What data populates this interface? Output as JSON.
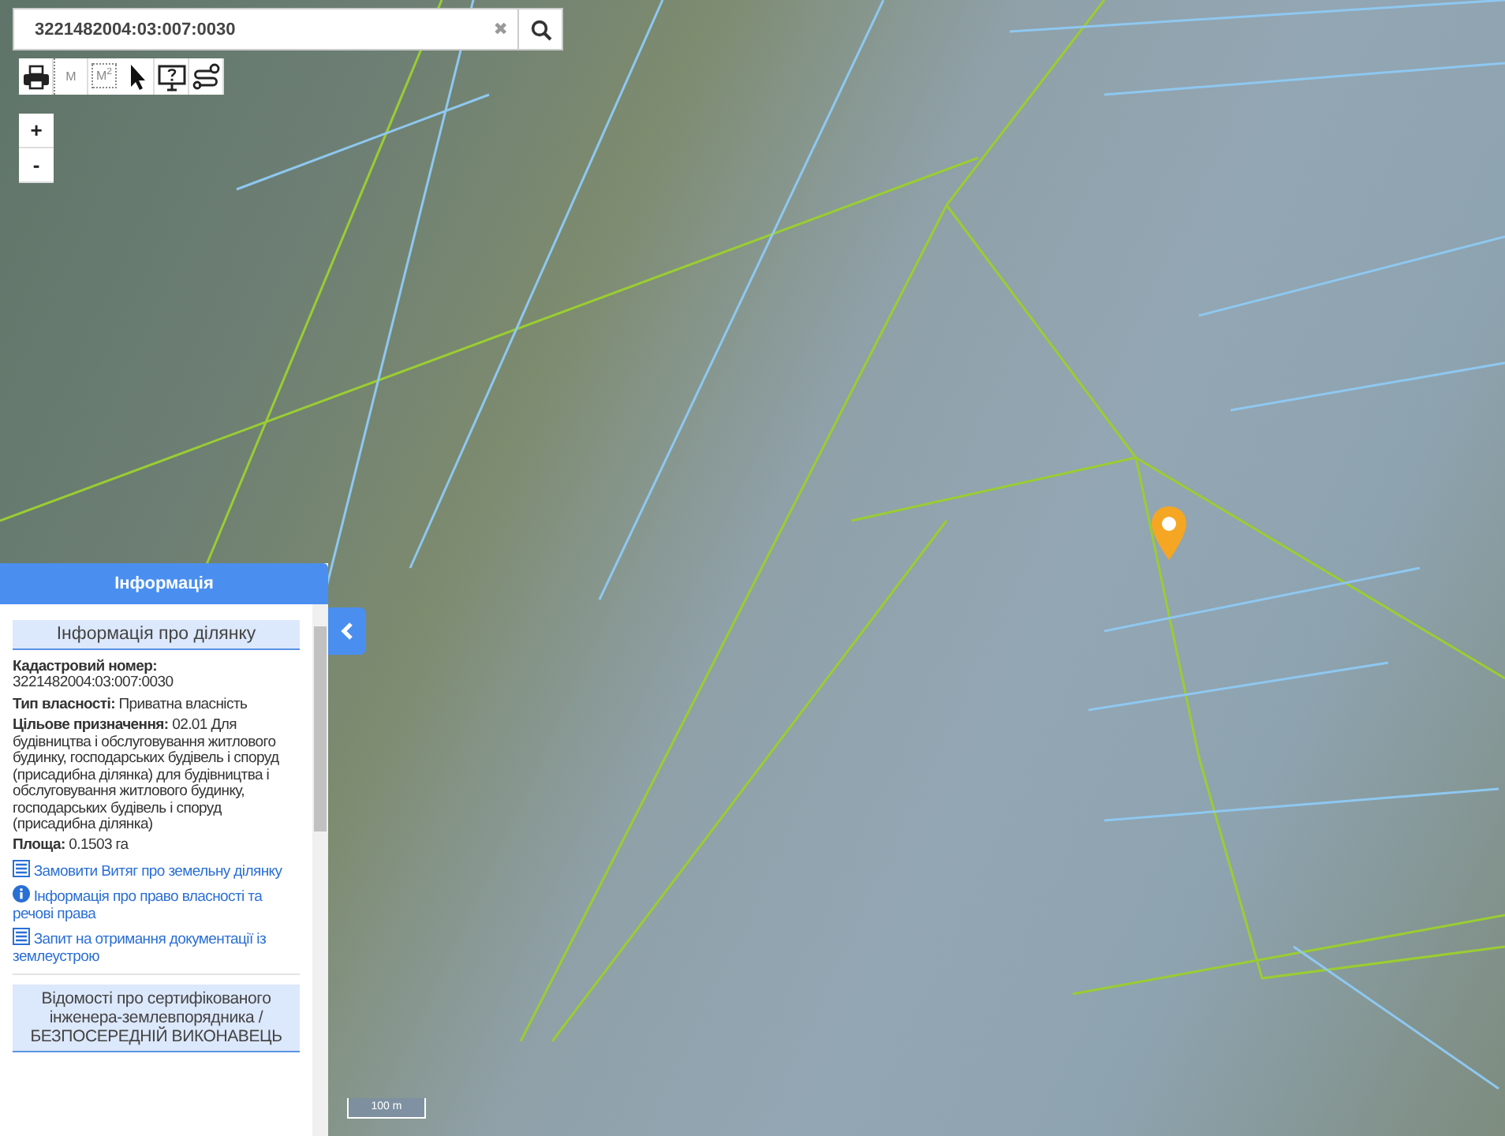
{
  "search": {
    "value": "3221482004:03:007:0030",
    "clear": "✖"
  },
  "toolbar": {
    "tools": [
      {
        "kind": "print"
      },
      {
        "kind": "distance",
        "label": "M"
      },
      {
        "kind": "area",
        "label": "M$^{2}$"
      },
      {
        "kind": "pointer"
      },
      {
        "kind": "help"
      },
      {
        "kind": "route"
      }
    ]
  },
  "zoom": {
    "buttons": [
      "+",
      "-"
    ]
  },
  "info_panel": {
    "title": "Інформація",
    "section_title": "Інформація про ділянку",
    "fields": [
      {
        "kind": "stacked",
        "label": "Кадастровий номер:",
        "value": "3221482004:03:007:0030"
      },
      {
        "kind": "inline",
        "label": "Тип власності:",
        "value": "Приватна власність"
      },
      {
        "kind": "inline",
        "label": "Цільове призначення:",
        "value": "02.01 Для будівництва і обслуговування житлового будинку, господарських будівель і споруд (присадибна ділянка) для будівництва і обслуговування житлового будинку, господарських будівель і споруд (присадибна ділянка)"
      },
      {
        "kind": "inline",
        "label": "Площа:",
        "value": "0.1503 га"
      }
    ],
    "links": [
      {
        "kind": "list",
        "text": "Замовити Витяг про земельну ділянку"
      },
      {
        "kind": "info",
        "text": "Інформація про право власності та речові права"
      },
      {
        "kind": "list",
        "text": "Запит на отримання документації із землеустрою"
      }
    ],
    "engineer_title": "Відомості про сертифікованого інженера-землевпорядника / БЕЗПОСЕРЕДНІЙ ВИКОНАВЕЦЬ"
  },
  "scale_bar": {
    "label": "100 m"
  }
}
